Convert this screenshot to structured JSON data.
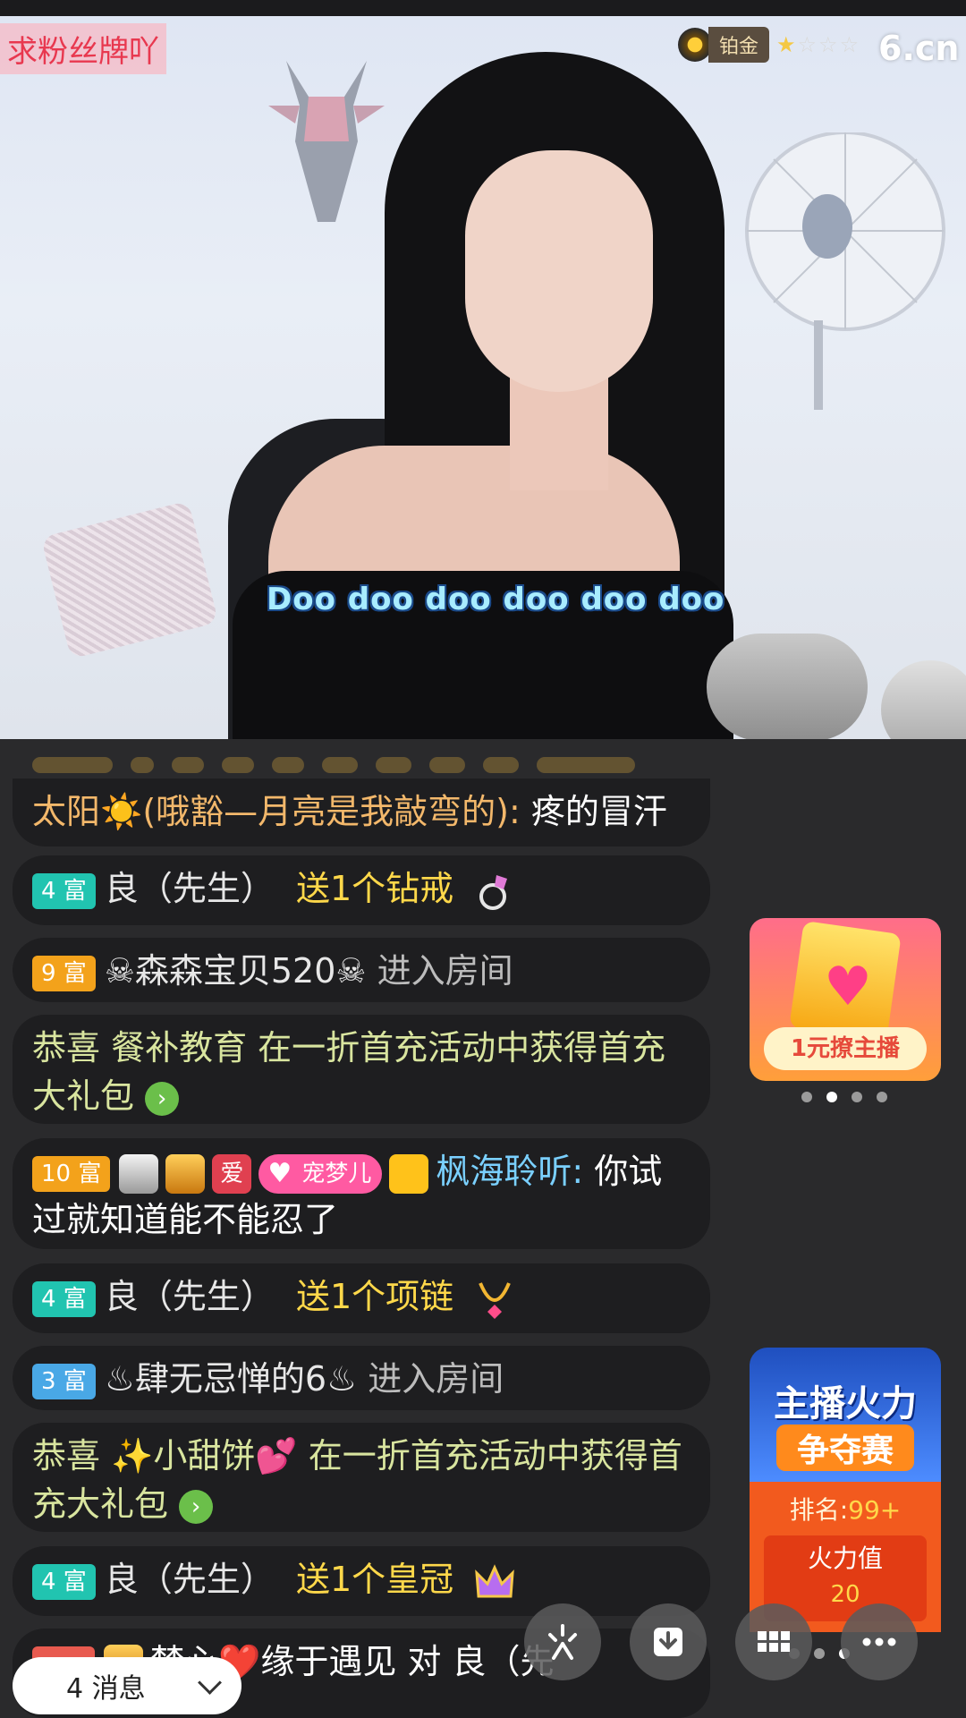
{
  "overlay": {
    "fan_banner": "求粉丝牌吖",
    "rank_label": "铂金",
    "stars": "★",
    "stars_dim": "☆☆☆",
    "site_logo": "6.cn",
    "subtitle": "Doo doo doo doo doo doo"
  },
  "chat": [
    {
      "sender": "太阳☀️(哦豁—月亮是我敲弯的)",
      "text": "疼的冒汗"
    },
    {
      "level": "4 富",
      "user": "良（先生）",
      "gift": "送1个钻戒"
    },
    {
      "level": "9 富",
      "user": "☠森森宝贝520☠",
      "action": "进入房间"
    },
    {
      "text": "恭喜 餐补教育 在一折首充活动中获得首充大礼包",
      "arrow": "›"
    },
    {
      "level": "10 富",
      "badge_love": "爱",
      "fan_badge": "宠梦儿",
      "user": "枫海聆听",
      "text": "你试过就知道能不能忍了"
    },
    {
      "level": "4 富",
      "user": "良（先生）",
      "gift": "送1个项链"
    },
    {
      "level": "3 富",
      "user": "♨肆无忌惮的6♨",
      "action": "进入房间"
    },
    {
      "text": "恭喜 ✨小甜饼💕 在一折首充活动中获得首充大礼包",
      "arrow": "›"
    },
    {
      "level": "4 富",
      "user": "良（先生）",
      "gift": "送1个皇冠"
    },
    {
      "text": "梦心❤️缘于遇见 对 良（先"
    }
  ],
  "promo": {
    "label": "1元撩主播"
  },
  "contest": {
    "title": "主播火力",
    "subtitle": "争夺赛",
    "rank_prefix": "排名:",
    "rank_value": "99+",
    "fire_label": "火力值",
    "fire_value": "20"
  },
  "bottom": {
    "messages": "4 消息"
  },
  "colors": {
    "chat_bubble": "#1e1e20",
    "gift_text": "#ffd84a",
    "congrats_text": "#d9e59f",
    "level_teal": "#21c4b0",
    "level_orange": "#f3a21b",
    "level_blue": "#49a8e6"
  }
}
